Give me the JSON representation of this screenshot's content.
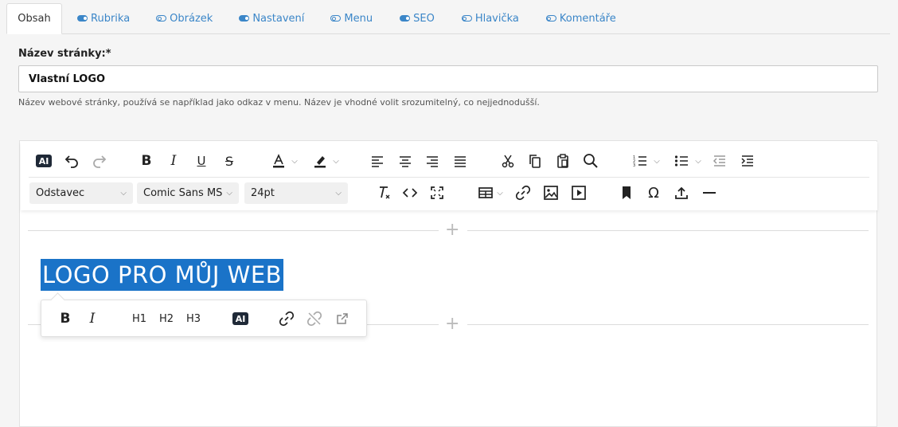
{
  "tabs": [
    {
      "label": "Obsah",
      "active": true,
      "toggle": "none"
    },
    {
      "label": "Rubrika",
      "active": false,
      "toggle": "on"
    },
    {
      "label": "Obrázek",
      "active": false,
      "toggle": "off"
    },
    {
      "label": "Nastavení",
      "active": false,
      "toggle": "on"
    },
    {
      "label": "Menu",
      "active": false,
      "toggle": "off"
    },
    {
      "label": "SEO",
      "active": false,
      "toggle": "on"
    },
    {
      "label": "Hlavička",
      "active": false,
      "toggle": "off"
    },
    {
      "label": "Komentáře",
      "active": false,
      "toggle": "off"
    }
  ],
  "form": {
    "title_label": "Název stránky:*",
    "title_value": "Vlastní LOGO",
    "title_hint": "Název webové stránky, používá se například jako odkaz v menu. Název je vhodné volit srozumitelný, co nejjednodušší."
  },
  "toolbar": {
    "ai_label": "AI",
    "block_format": "Odstavec",
    "font_family": "Comic Sans MS",
    "font_size": "24pt",
    "icons_row1": [
      "ai-icon",
      "undo-icon",
      "redo-icon",
      "bold-icon",
      "italic-icon",
      "underline-icon",
      "strikethrough-icon",
      "text-color-icon",
      "highlight-icon",
      "align-left-icon",
      "align-center-icon",
      "align-right-icon",
      "align-justify-icon",
      "cut-icon",
      "copy-icon",
      "paste-icon",
      "search-icon",
      "numbered-list-icon",
      "bullet-list-icon",
      "outdent-icon",
      "indent-icon"
    ],
    "icons_row2": [
      "clear-format-icon",
      "code-icon",
      "fullscreen-icon",
      "table-icon",
      "link-icon",
      "image-icon",
      "media-icon",
      "bookmark-icon",
      "special-char-icon",
      "upload-icon",
      "horizontal-rule-icon"
    ]
  },
  "content": {
    "heading_text": "LOGO PRO MŮJ WEB"
  },
  "bubble_toolbar": {
    "bold": "B",
    "italic": "I",
    "h1": "H1",
    "h2": "H2",
    "h3": "H3",
    "ai": "AI"
  },
  "colors": {
    "accent": "#3b86c8",
    "selection": "#1a73c8",
    "ai_badge": "#1f2937"
  }
}
